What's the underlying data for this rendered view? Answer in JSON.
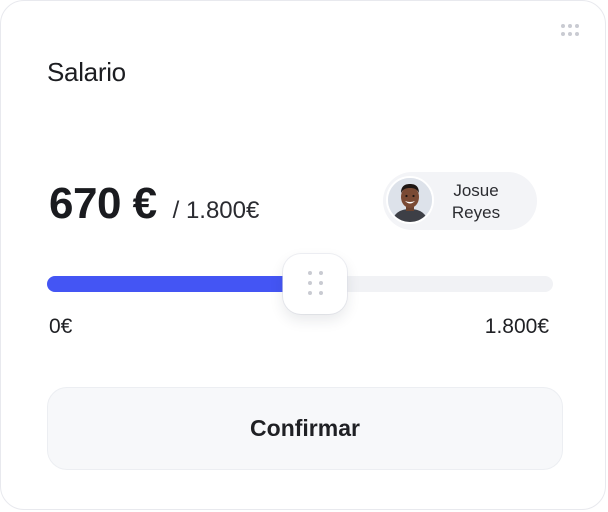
{
  "card": {
    "title": "Salario"
  },
  "icons": {
    "drag_handle": "drag-dots-icon",
    "thumb_grip": "grip-dots-icon"
  },
  "amount": {
    "current": "670 €",
    "total": "/ 1.800€"
  },
  "user": {
    "first_name": "Josue",
    "last_name": "Reyes"
  },
  "slider": {
    "min_label": "0€",
    "max_label": "1.800€",
    "min": 0,
    "max": 1800,
    "value": 670,
    "fill_fraction": 0.53,
    "fill_color": "#4455f4",
    "track_color": "#f1f2f5"
  },
  "actions": {
    "confirm_label": "Confirmar"
  }
}
